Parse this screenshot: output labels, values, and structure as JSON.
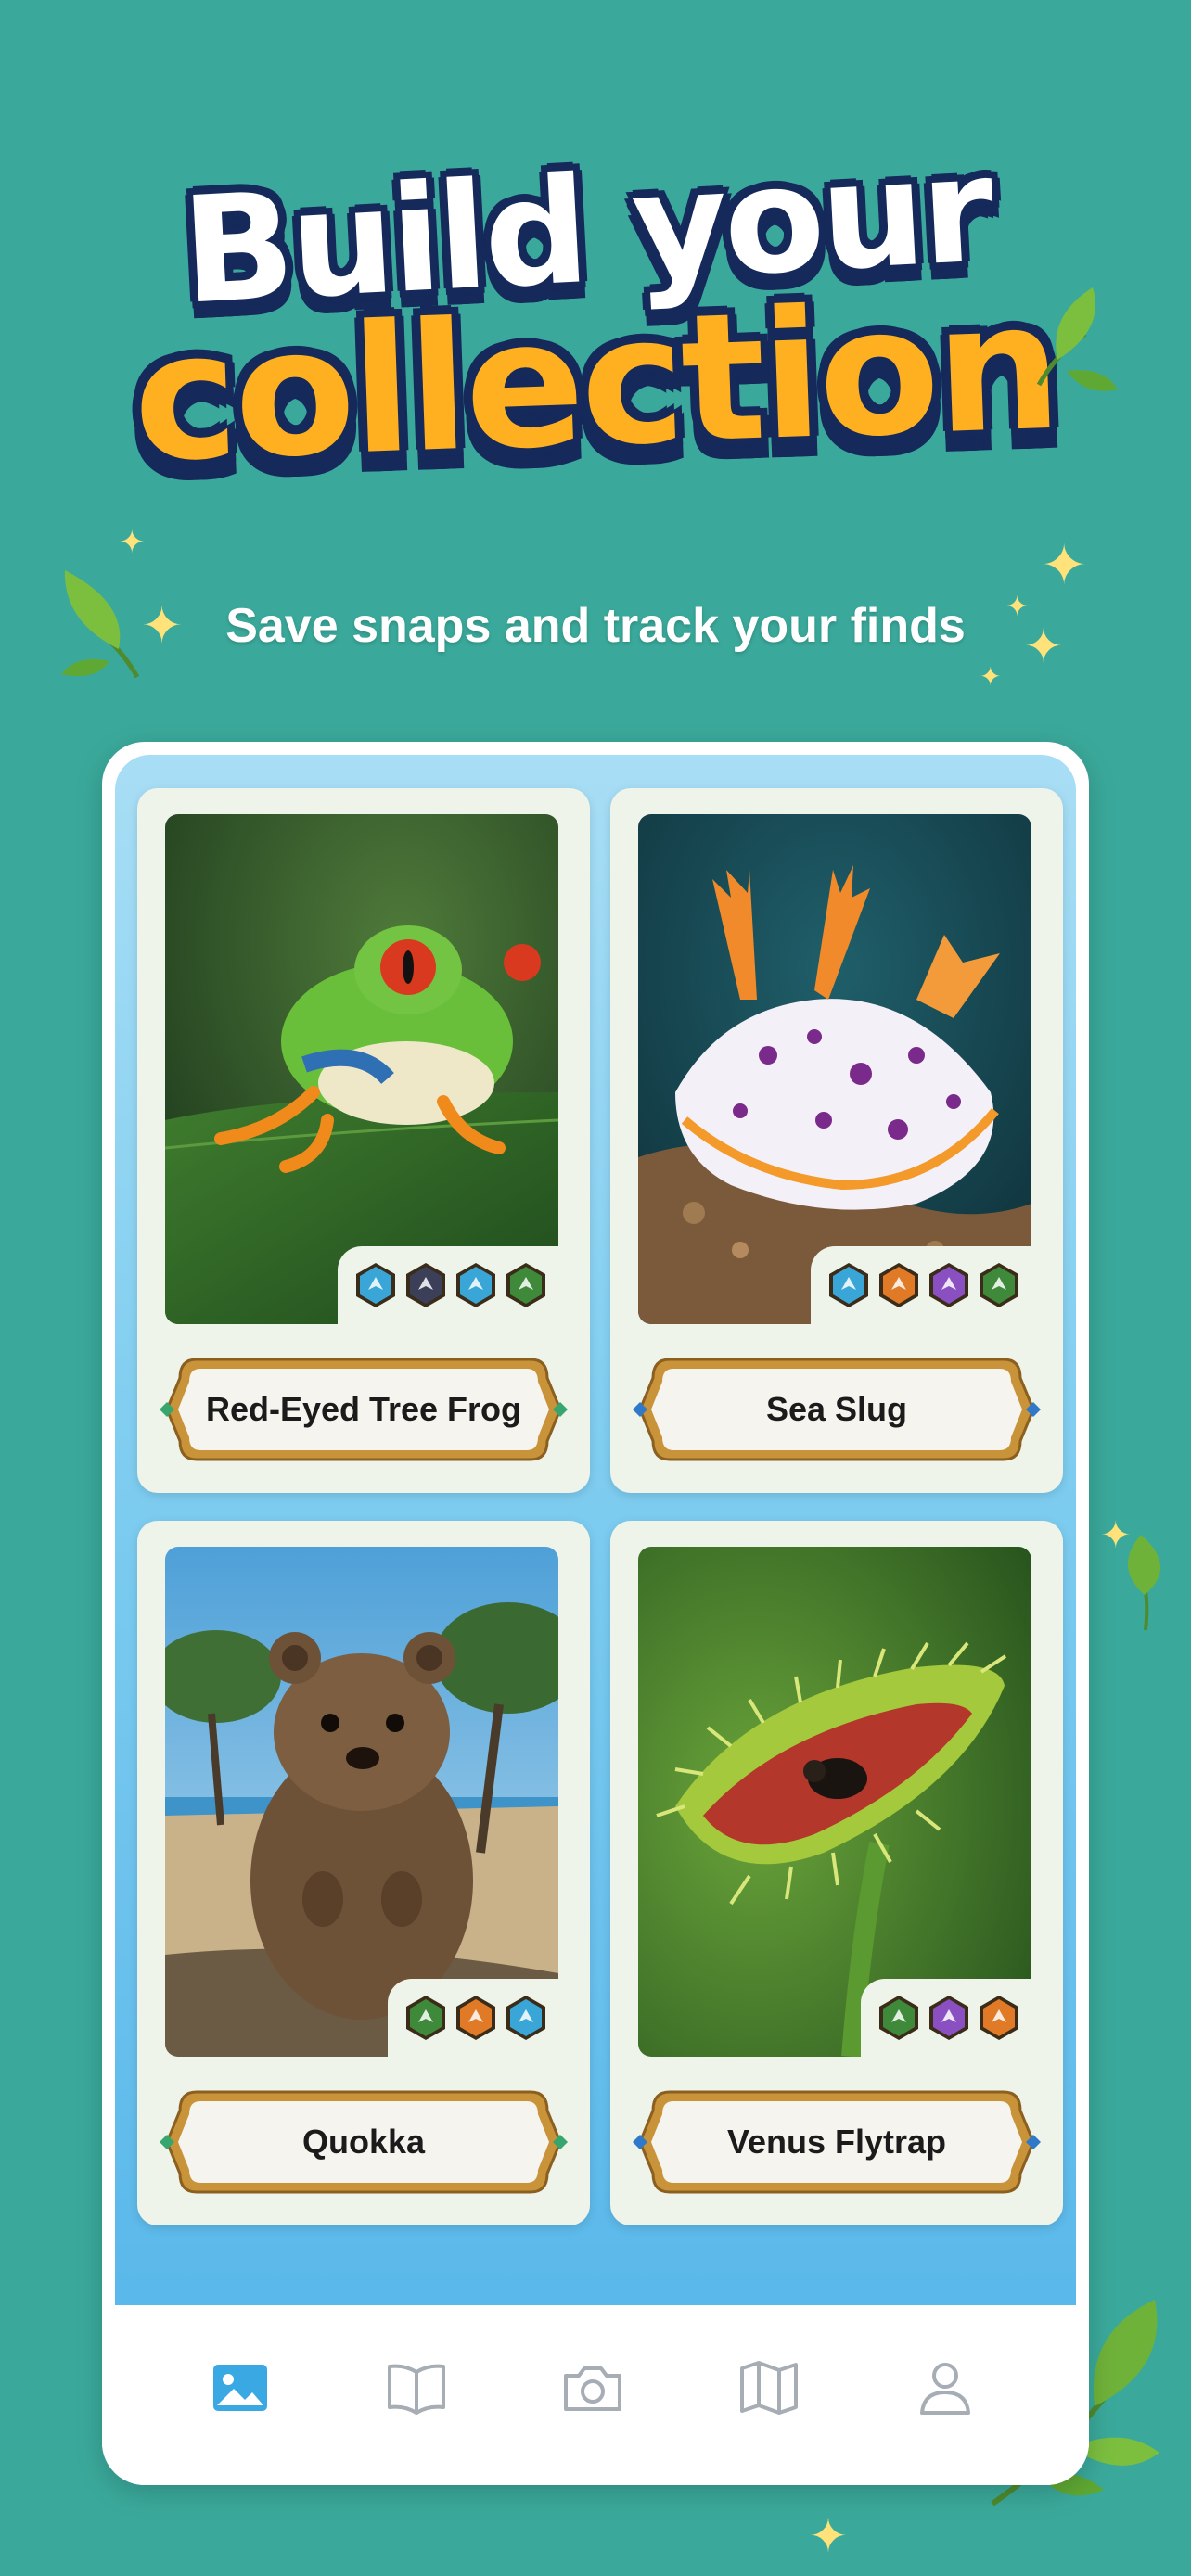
{
  "headline": {
    "line1": "Build your",
    "line2": "collection"
  },
  "subtitle": "Save snaps and track your finds",
  "collection": [
    {
      "name": "Red-Eyed Tree Frog",
      "badges": [
        "blue",
        "dark",
        "blue",
        "green"
      ]
    },
    {
      "name": "Sea Slug",
      "badges": [
        "blue",
        "orange",
        "purple",
        "green"
      ]
    },
    {
      "name": "Quokka",
      "badges": [
        "green",
        "orange",
        "blue"
      ]
    },
    {
      "name": "Venus Flytrap",
      "badges": [
        "green",
        "purple",
        "orange"
      ]
    }
  ],
  "badge_colors": {
    "blue": "#3aa6d8",
    "dark": "#3b3f58",
    "green": "#3f8a3a",
    "orange": "#e07a26",
    "purple": "#8a4fc0"
  },
  "tabbar": {
    "active_color": "#39a8e3",
    "inactive_color": "#a6adb4",
    "tabs": [
      {
        "icon": "gallery-icon",
        "active": true
      },
      {
        "icon": "book-icon",
        "active": false
      },
      {
        "icon": "camera-icon",
        "active": false
      },
      {
        "icon": "map-icon",
        "active": false
      },
      {
        "icon": "profile-icon",
        "active": false
      }
    ]
  }
}
